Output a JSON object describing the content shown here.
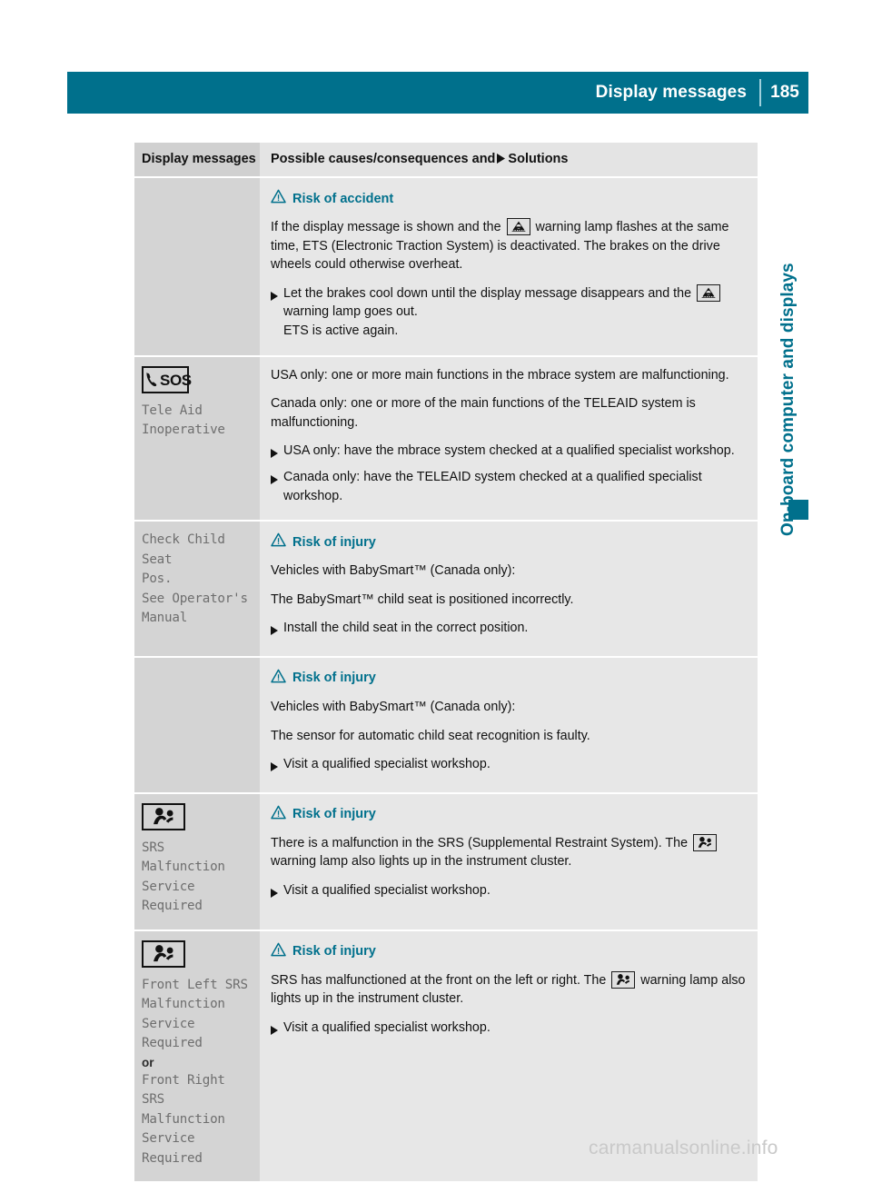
{
  "header": {
    "title": "Display messages",
    "page_number": "185",
    "accent_color": "#00708c"
  },
  "side_tab": {
    "label": "On-board computer and displays"
  },
  "table": {
    "columns": {
      "left": "Display messages",
      "right_prefix": "Possible causes/consequences and",
      "right_suffix": "Solutions"
    },
    "rows": [
      {
        "left": {
          "icon": "none",
          "message": ""
        },
        "right": {
          "warning": "Risk of accident",
          "paragraphs": [
            {
              "parts": [
                {
                  "t": "text",
                  "v": "If the display message is shown and the "
                },
                {
                  "t": "lamp",
                  "v": "ets-warning-lamp"
                },
                {
                  "t": "text",
                  "v": " warning lamp flashes at the same time, ETS (Electronic Traction System) is deactivated. The brakes on the drive wheels could otherwise overheat."
                }
              ]
            }
          ],
          "bullets": [
            {
              "parts": [
                {
                  "t": "text",
                  "v": "Let the brakes cool down until the display message disappears and the "
                },
                {
                  "t": "lamp",
                  "v": "ets-warning-lamp"
                },
                {
                  "t": "text",
                  "v": " warning lamp goes out."
                },
                {
                  "t": "break",
                  "v": ""
                },
                {
                  "t": "text",
                  "v": "ETS is active again."
                }
              ]
            }
          ]
        }
      },
      {
        "left": {
          "icon": "sos-call-icon",
          "icon_label": "SOS",
          "message": "Tele Aid\nInoperative"
        },
        "right": {
          "warning": "",
          "paragraphs": [
            {
              "parts": [
                {
                  "t": "text",
                  "v": "USA only: one or more main functions in the mbrace system are malfunctioning."
                }
              ]
            },
            {
              "parts": [
                {
                  "t": "text",
                  "v": "Canada only: one or more of the main functions of the TELEAID system is malfunctioning."
                }
              ]
            }
          ],
          "bullets": [
            {
              "parts": [
                {
                  "t": "text",
                  "v": "USA only: have the mbrace system checked at a qualified specialist workshop."
                }
              ]
            },
            {
              "parts": [
                {
                  "t": "text",
                  "v": "Canada only: have the TELEAID system checked at a qualified specialist workshop."
                }
              ]
            }
          ]
        }
      },
      {
        "left": {
          "icon": "none",
          "message": "Check Child Seat\nPos.\nSee Operator's\nManual"
        },
        "right": {
          "warning": "Risk of injury",
          "paragraphs": [
            {
              "parts": [
                {
                  "t": "text",
                  "v": "Vehicles with BabySmart™ (Canada only):"
                }
              ]
            },
            {
              "parts": [
                {
                  "t": "text",
                  "v": "The BabySmart™ child seat is positioned incorrectly."
                }
              ]
            }
          ],
          "bullets": [
            {
              "parts": [
                {
                  "t": "text",
                  "v": "Install the child seat in the correct position."
                }
              ]
            }
          ]
        }
      },
      {
        "left": {
          "icon": "none",
          "message": ""
        },
        "right": {
          "warning": "Risk of injury",
          "paragraphs": [
            {
              "parts": [
                {
                  "t": "text",
                  "v": "Vehicles with BabySmart™ (Canada only):"
                }
              ]
            },
            {
              "parts": [
                {
                  "t": "text",
                  "v": "The sensor for automatic child seat recognition is faulty."
                }
              ]
            }
          ],
          "bullets": [
            {
              "parts": [
                {
                  "t": "text",
                  "v": "Visit a qualified specialist workshop."
                }
              ]
            }
          ]
        }
      },
      {
        "left": {
          "icon": "srs-airbag-icon",
          "message": "SRS Malfunction\nService Required"
        },
        "right": {
          "warning": "Risk of injury",
          "paragraphs": [
            {
              "parts": [
                {
                  "t": "text",
                  "v": "There is a malfunction in the SRS (Supplemental Restraint System). The "
                },
                {
                  "t": "lamp",
                  "v": "srs-airbag-lamp"
                },
                {
                  "t": "text",
                  "v": " warning lamp also lights up in the instrument cluster."
                }
              ]
            }
          ],
          "bullets": [
            {
              "parts": [
                {
                  "t": "text",
                  "v": "Visit a qualified specialist workshop."
                }
              ]
            }
          ]
        }
      },
      {
        "left": {
          "icon": "srs-airbag-icon",
          "message": "Front Left SRS\nMalfunction\nService Required",
          "separator": "or",
          "message2": "Front Right SRS\nMalfunction\nService Required"
        },
        "right": {
          "warning": "Risk of injury",
          "paragraphs": [
            {
              "parts": [
                {
                  "t": "text",
                  "v": "SRS has malfunctioned at the front on the left or right. The "
                },
                {
                  "t": "lamp",
                  "v": "srs-airbag-lamp"
                },
                {
                  "t": "text",
                  "v": " warning lamp also lights up in the instrument cluster."
                }
              ]
            }
          ],
          "bullets": [
            {
              "parts": [
                {
                  "t": "text",
                  "v": "Visit a qualified specialist workshop."
                }
              ]
            }
          ]
        }
      }
    ]
  },
  "watermark": "carmanualsonline.info"
}
